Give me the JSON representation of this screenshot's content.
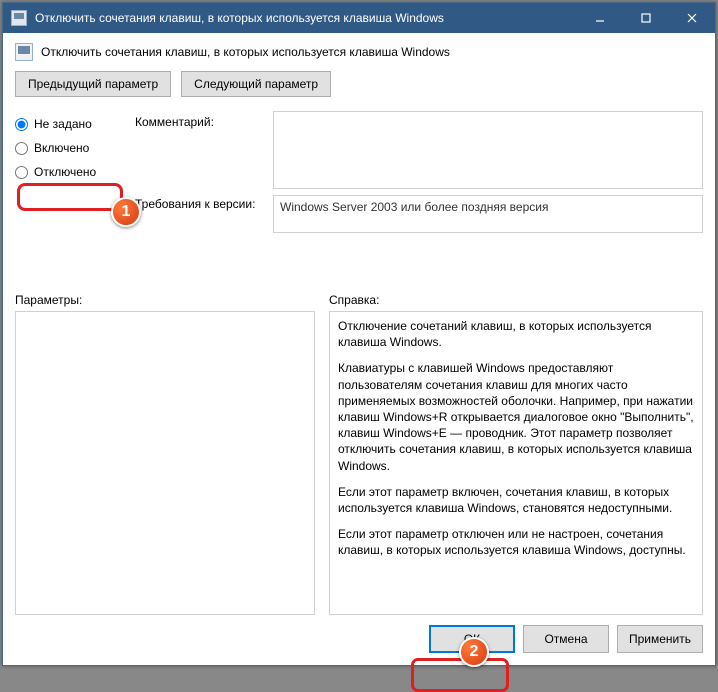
{
  "titlebar": {
    "title": "Отключить сочетания клавиш, в которых используется клавиша Windows"
  },
  "header": {
    "text": "Отключить сочетания клавиш, в которых используется клавиша Windows"
  },
  "nav": {
    "prev": "Предыдущий параметр",
    "next": "Следующий параметр"
  },
  "radios": {
    "not_configured": "Не задано",
    "enabled": "Включено",
    "disabled": "Отключено"
  },
  "labels": {
    "comment": "Комментарий:",
    "requirements": "Требования к версии:",
    "params": "Параметры:",
    "help": "Справка:"
  },
  "requirements_text": "Windows Server 2003 или более поздняя версия",
  "help": {
    "p1": "Отключение сочетаний клавиш, в которых используется клавиша Windows.",
    "p2": "Клавиатуры с клавишей Windows предоставляют пользователям сочетания клавиш для многих часто применяемых возможностей оболочки. Например, при нажатии клавиш Windows+R открывается диалоговое окно \"Выполнить\", клавиш Windows+E — проводник. Этот параметр позволяет отключить сочетания клавиш, в которых используется клавиша Windows.",
    "p3": "Если этот параметр включен, сочетания клавиш, в которых используется клавиша Windows, становятся недоступными.",
    "p4": "Если этот параметр отключен или не настроен, сочетания клавиш, в которых используется клавиша Windows, доступны."
  },
  "footer": {
    "ok": "ОК",
    "cancel": "Отмена",
    "apply": "Применить"
  },
  "annotations": {
    "badge1": "1",
    "badge2": "2"
  }
}
